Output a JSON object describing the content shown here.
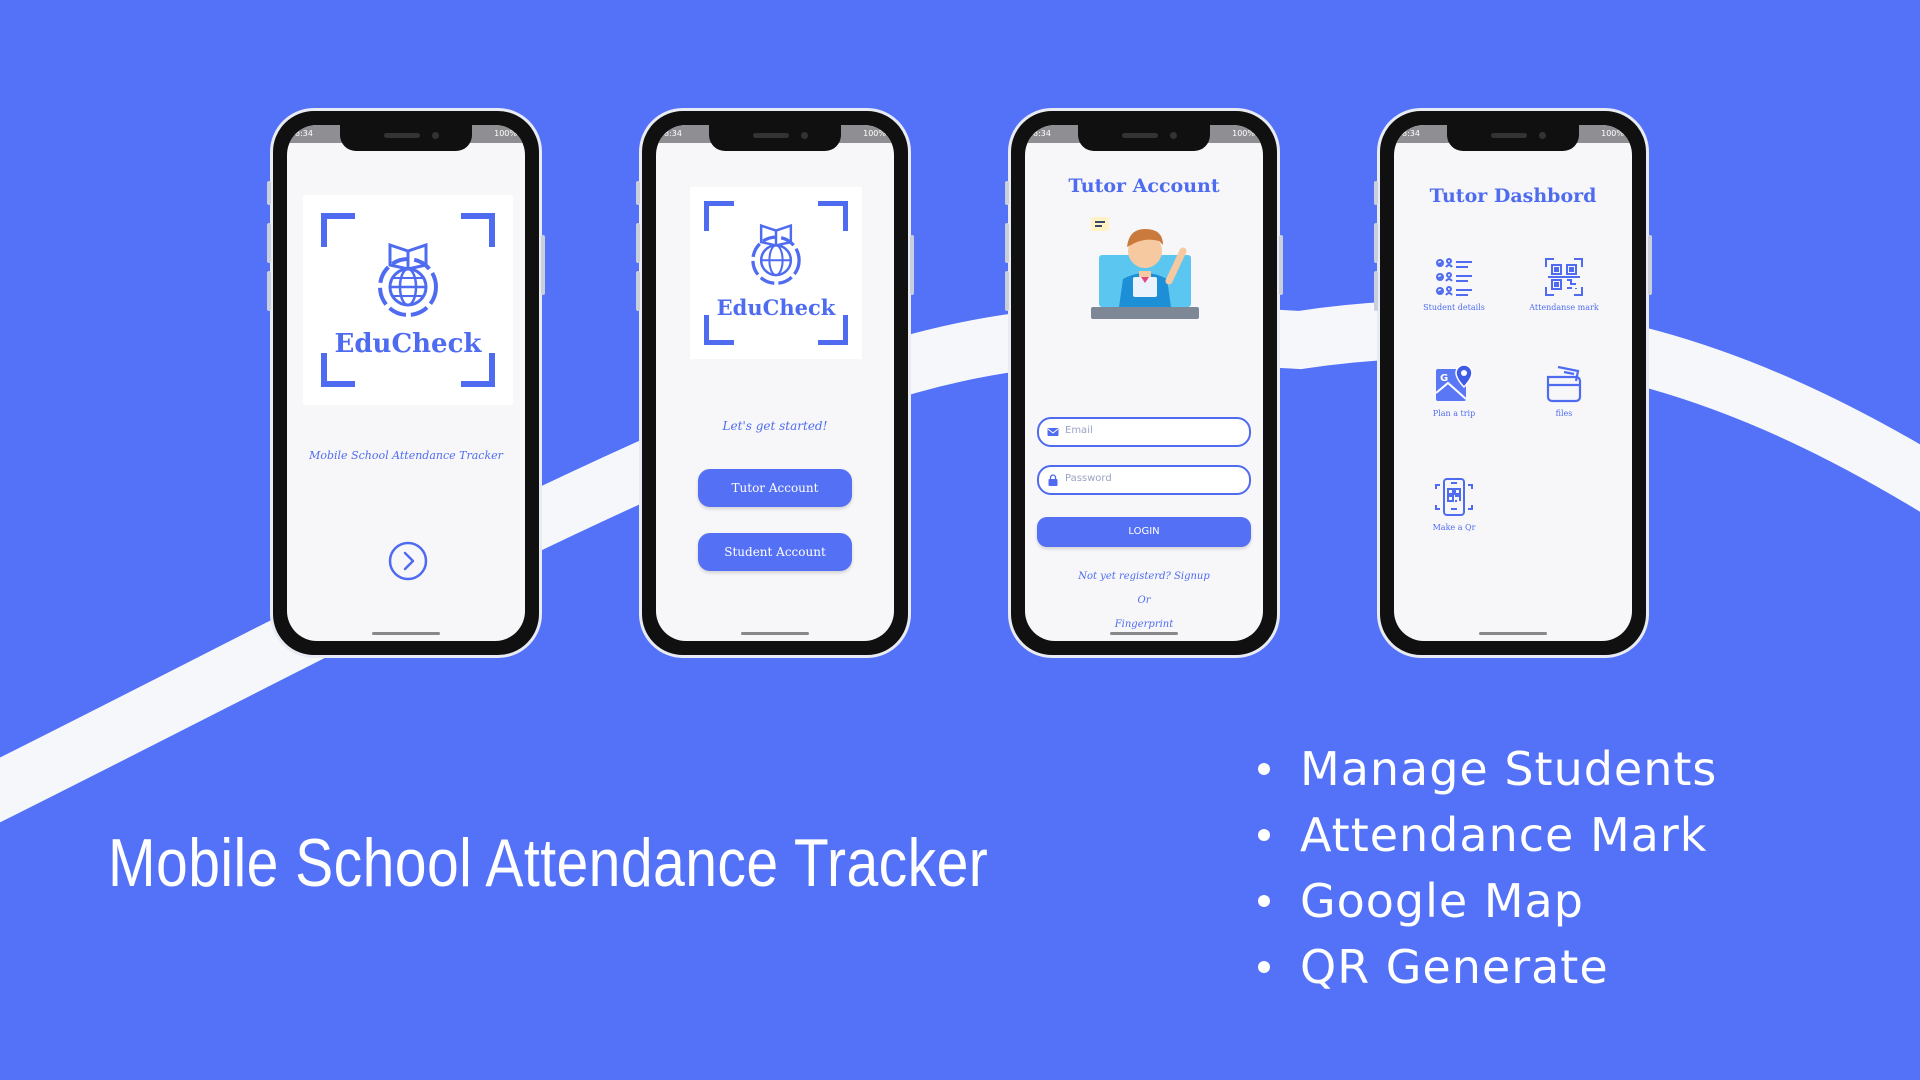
{
  "colors": {
    "background": "#5472f8",
    "accent": "#4f6cf0",
    "button": "#5470f5",
    "road": "#f6f7fb"
  },
  "status_bar": {
    "time": "8:34",
    "battery": "100%"
  },
  "phone1": {
    "logo_text": "EduCheck",
    "subtitle": "Mobile School Attendance Tracker",
    "next_icon": "chevron-right-circle-icon"
  },
  "phone2": {
    "logo_text": "EduCheck",
    "prompt": "Let's get started!",
    "tutor_button": "Tutor Account",
    "student_button": "Student Account"
  },
  "phone3": {
    "title": "Tutor Account",
    "email_placeholder": "Email",
    "password_placeholder": "Password",
    "login_button": "LOGIN",
    "signup_link": "Not yet registerd? Signup",
    "or_text": "Or",
    "fingerprint_link": "Fingerprint"
  },
  "phone4": {
    "title": "Tutor Dashbord",
    "items": [
      {
        "label": "Student details",
        "icon": "checklist-icon"
      },
      {
        "label": "Attendanse mark",
        "icon": "qr-scan-icon"
      },
      {
        "label": "Plan a trip",
        "icon": "map-pin-icon"
      },
      {
        "label": "files",
        "icon": "folder-icon"
      },
      {
        "label": "Make a Qr",
        "icon": "qr-phone-icon"
      }
    ]
  },
  "headline": "Mobile School Attendance Tracker",
  "features": [
    "Manage Students",
    "Attendance Mark",
    "Google Map",
    "QR Generate"
  ]
}
